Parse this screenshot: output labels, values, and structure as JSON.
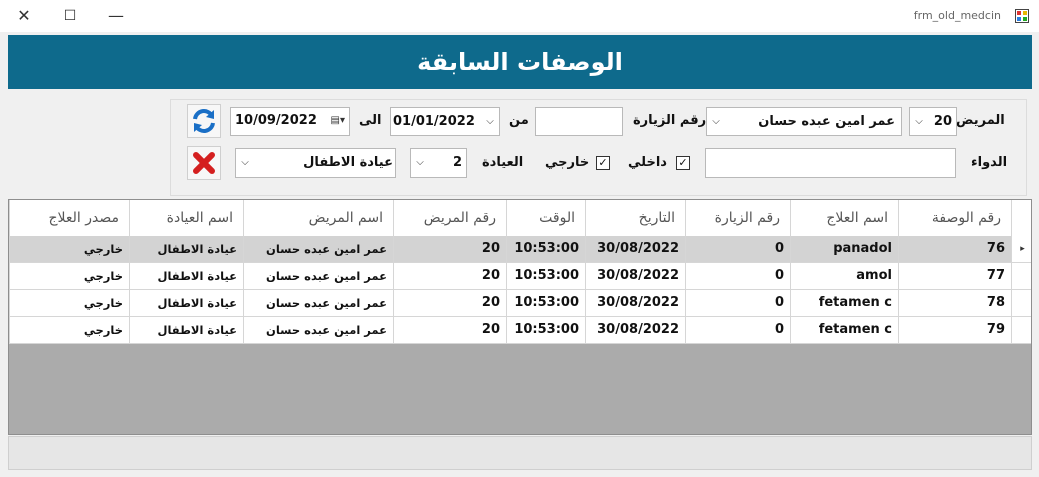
{
  "window": {
    "title": "frm_old_medcin",
    "close_glyph": "✕",
    "maximize_glyph": "☐",
    "minimize_glyph": "—"
  },
  "banner": {
    "title": "الوصفات السابقة",
    "color": "#0e6a8c"
  },
  "filters": {
    "patient_label": "المريض",
    "patient_id": "20",
    "patient_name": "عمر  امين عبده حسان",
    "visit_label": "رقم الزيارة",
    "visit_value": "",
    "from_label": "من",
    "from_date": "01/01/2022",
    "to_label": "الى",
    "to_date": "10/09/2022",
    "medicine_label": "الدواء",
    "medicine_value": "",
    "inside_label": "داخلي",
    "inside_checked": true,
    "outside_label": "خارجي",
    "outside_checked": true,
    "clinic_label": "العيادة",
    "clinic_id": "2",
    "clinic_name": "عيادة الاطفال",
    "refresh_icon": "refresh-icon",
    "clear_icon": "clear-x-icon"
  },
  "grid": {
    "headers": [
      "رقم الوصفة",
      "اسم العلاج",
      "رقم الزيارة",
      "التاريخ",
      "الوقت",
      "رقم المريض",
      "اسم المريض",
      "اسم العيادة",
      "مصدر العلاج"
    ],
    "rows": [
      [
        "76",
        "panadol",
        "0",
        "30/08/2022",
        "10:53:00",
        "20",
        "عمر  امين عبده حسان",
        "عيادة الاطفال",
        "خارجي"
      ],
      [
        "77",
        "amol",
        "0",
        "30/08/2022",
        "10:53:00",
        "20",
        "عمر  امين عبده حسان",
        "عيادة الاطفال",
        "خارجي"
      ],
      [
        "78",
        "fetamen c",
        "0",
        "30/08/2022",
        "10:53:00",
        "20",
        "عمر  امين عبده حسان",
        "عيادة الاطفال",
        "خارجي"
      ],
      [
        "79",
        "fetamen c",
        "0",
        "30/08/2022",
        "10:53:00",
        "20",
        "عمر  امين عبده حسان",
        "عيادة الاطفال",
        "خارجي"
      ]
    ],
    "selected_row": 0,
    "current_row_marker": "▸"
  }
}
